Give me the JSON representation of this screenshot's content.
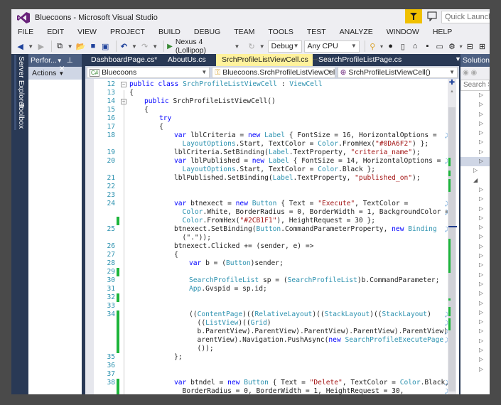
{
  "window": {
    "title": "Bluecoons - Microsoft Visual Studio",
    "quick_launch_placeholder": "Quick Launch (Ctrl+Q)"
  },
  "menu": [
    "FILE",
    "EDIT",
    "VIEW",
    "PROJECT",
    "BUILD",
    "DEBUG",
    "TEAM",
    "TOOLS",
    "TEST",
    "ANALYZE",
    "WINDOW",
    "HELP"
  ],
  "toolbar": {
    "run_target": "Nexus 4 (Lollipop)",
    "configuration": "Debug",
    "platform": "Any CPU"
  },
  "side_tabs": [
    "Server Explorer",
    "Toolbox"
  ],
  "perf_panel": {
    "title": "Perfor...",
    "actions_label": "Actions"
  },
  "doc_tabs": [
    {
      "label": "DashboardPage.cs*",
      "active": false
    },
    {
      "label": "AboutUs.cs",
      "active": false
    },
    {
      "label": "SrchProfileListViewCell.cs",
      "active": true
    },
    {
      "label": "SearchProfileListPage.cs",
      "active": false
    }
  ],
  "navbar": {
    "project": "Bluecoons",
    "type": "Bluecoons.SrchProfileListViewCell",
    "member": "SrchProfileListViewCell()"
  },
  "solution_explorer": {
    "title": "Solution Explorer",
    "search_placeholder": "Search Solution Explorer"
  },
  "code_lines": [
    {
      "n": "12",
      "fold": true,
      "segs": [
        [
          "kw",
          "public class "
        ],
        [
          "ty",
          "SrchProfileListViewCell"
        ],
        [
          "",
          " : "
        ],
        [
          "ty",
          "ViewCell"
        ]
      ],
      "indent": 0
    },
    {
      "n": "13",
      "segs": [
        [
          "",
          "{"
        ]
      ],
      "indent": 0
    },
    {
      "n": "14",
      "fold": true,
      "segs": [
        [
          "kw",
          "public "
        ],
        [
          "",
          "SrchProfileListViewCell()"
        ]
      ],
      "indent": 1
    },
    {
      "n": "15",
      "segs": [
        [
          "",
          "{"
        ]
      ],
      "indent": 1
    },
    {
      "n": "16",
      "segs": [
        [
          "kw",
          "try"
        ]
      ],
      "indent": 2
    },
    {
      "n": "17",
      "segs": [
        [
          "",
          "{"
        ]
      ],
      "indent": 2
    },
    {
      "n": "18",
      "wrap": true,
      "segs": [
        [
          "kw",
          "var "
        ],
        [
          "",
          "lblCriteria = "
        ],
        [
          "kw",
          "new "
        ],
        [
          "ty",
          "Label"
        ],
        [
          "",
          " { FontSize = 16, HorizontalOptions = "
        ]
      ],
      "indent": 3
    },
    {
      "n": "",
      "segs": [
        [
          "ty",
          "  LayoutOptions"
        ],
        [
          "",
          ".Start, TextColor = "
        ],
        [
          "ty",
          "Color"
        ],
        [
          "",
          ".FromHex("
        ],
        [
          "st",
          "\"#0DA6F2\""
        ],
        [
          "",
          ") };"
        ]
      ],
      "indent": 3
    },
    {
      "n": "19",
      "segs": [
        [
          "",
          "lblCriteria.SetBinding("
        ],
        [
          "ty",
          "Label"
        ],
        [
          "",
          ".TextProperty, "
        ],
        [
          "st",
          "\"criteria_name\""
        ],
        [
          "",
          ");"
        ]
      ],
      "indent": 3
    },
    {
      "n": "20",
      "wrap": true,
      "segs": [
        [
          "kw",
          "var "
        ],
        [
          "",
          "lblPublished = "
        ],
        [
          "kw",
          "new "
        ],
        [
          "ty",
          "Label"
        ],
        [
          "",
          " { FontSize = 14, HorizontalOptions = "
        ]
      ],
      "indent": 3
    },
    {
      "n": "",
      "segs": [
        [
          "ty",
          "  LayoutOptions"
        ],
        [
          "",
          ".Start, TextColor = "
        ],
        [
          "ty",
          "Color"
        ],
        [
          "",
          ".Black };"
        ]
      ],
      "indent": 3
    },
    {
      "n": "21",
      "segs": [
        [
          "",
          "lblPublished.SetBinding("
        ],
        [
          "ty",
          "Label"
        ],
        [
          "",
          ".TextProperty, "
        ],
        [
          "st",
          "\"published_on\""
        ],
        [
          "",
          ");"
        ]
      ],
      "indent": 3
    },
    {
      "n": "22",
      "segs": [],
      "indent": 3
    },
    {
      "n": "23",
      "segs": [],
      "indent": 3
    },
    {
      "n": "24",
      "wrap": true,
      "segs": [
        [
          "kw",
          "var "
        ],
        [
          "",
          "btnexect = "
        ],
        [
          "kw",
          "new "
        ],
        [
          "ty",
          "Button"
        ],
        [
          "",
          " { Text = "
        ],
        [
          "st",
          "\"Execute\""
        ],
        [
          "",
          ", TextColor = "
        ]
      ],
      "indent": 3
    },
    {
      "n": "",
      "wrap": true,
      "segs": [
        [
          "ty",
          "  Color"
        ],
        [
          "",
          ".White, BorderRadius = 0, BorderWidth = 1, BackgroundColor = "
        ]
      ],
      "indent": 3
    },
    {
      "n": "",
      "chg": true,
      "segs": [
        [
          "ty",
          "  Color"
        ],
        [
          "",
          ".FromHex("
        ],
        [
          "st",
          "\"#2CB1F1\""
        ],
        [
          "",
          "), HeightRequest = 30 };"
        ]
      ],
      "indent": 3
    },
    {
      "n": "25",
      "wrap": true,
      "segs": [
        [
          "",
          "btnexect.SetBinding("
        ],
        [
          "ty",
          "Button"
        ],
        [
          "",
          ".CommandParameterProperty, "
        ],
        [
          "kw",
          "new "
        ],
        [
          "ty",
          "Binding"
        ]
      ],
      "indent": 3
    },
    {
      "n": "",
      "segs": [
        [
          "",
          "  (\".\"));"
        ]
      ],
      "indent": 3
    },
    {
      "n": "26",
      "segs": [
        [
          "",
          "btnexect.Clicked += (sender, e) =>"
        ]
      ],
      "indent": 3
    },
    {
      "n": "27",
      "segs": [
        [
          "",
          "{"
        ]
      ],
      "indent": 3
    },
    {
      "n": "28",
      "segs": [
        [
          "kw",
          "var "
        ],
        [
          "",
          "b = ("
        ],
        [
          "ty",
          "Button"
        ],
        [
          "",
          ")sender;"
        ]
      ],
      "indent": 4
    },
    {
      "n": "29",
      "chg": true,
      "segs": [],
      "indent": 4
    },
    {
      "n": "30",
      "segs": [
        [
          "ty",
          "SearchProfileList"
        ],
        [
          "",
          " sp = ("
        ],
        [
          "ty",
          "SearchProfileList"
        ],
        [
          "",
          ")b.CommandParameter;"
        ]
      ],
      "indent": 4
    },
    {
      "n": "31",
      "segs": [
        [
          "ty",
          "App"
        ],
        [
          "",
          ".Gvspid = sp.id;"
        ]
      ],
      "indent": 4
    },
    {
      "n": "32",
      "chg": true,
      "segs": [],
      "indent": 4
    },
    {
      "n": "33",
      "segs": [],
      "indent": 4
    },
    {
      "n": "34",
      "chg": true,
      "wrap": true,
      "segs": [
        [
          "",
          "(("
        ],
        [
          "ty",
          "ContentPage"
        ],
        [
          "",
          ")(("
        ],
        [
          "ty",
          "RelativeLayout"
        ],
        [
          "",
          ")(("
        ],
        [
          "ty",
          "StackLayout"
        ],
        [
          "",
          ")(("
        ],
        [
          "ty",
          "StackLayout"
        ],
        [
          "",
          ")"
        ]
      ],
      "indent": 4
    },
    {
      "n": "",
      "chg": true,
      "wrap": true,
      "segs": [
        [
          "",
          "  (("
        ],
        [
          "ty",
          "ListView"
        ],
        [
          "",
          ")(("
        ],
        [
          "ty",
          "Grid"
        ],
        [
          "",
          ")"
        ]
      ],
      "indent": 4
    },
    {
      "n": "",
      "chg": true,
      "wrap": true,
      "segs": [
        [
          "",
          "  b.ParentView).ParentView).ParentView).ParentView).ParentView).P"
        ]
      ],
      "indent": 4
    },
    {
      "n": "",
      "chg": true,
      "wrap": true,
      "segs": [
        [
          "",
          "  arentView).Navigation.PushAsync("
        ],
        [
          "kw",
          "new "
        ],
        [
          "ty",
          "SearchProfileExecutePage"
        ]
      ],
      "indent": 4
    },
    {
      "n": "",
      "chg": true,
      "segs": [
        [
          "",
          "  ());"
        ]
      ],
      "indent": 4
    },
    {
      "n": "35",
      "segs": [
        [
          "",
          "};"
        ]
      ],
      "indent": 3
    },
    {
      "n": "36",
      "segs": [],
      "indent": 3
    },
    {
      "n": "37",
      "segs": [],
      "indent": 3
    },
    {
      "n": "38",
      "chg": true,
      "wrap": true,
      "segs": [
        [
          "kw",
          "var "
        ],
        [
          "",
          "btndel = "
        ],
        [
          "kw",
          "new "
        ],
        [
          "ty",
          "Button"
        ],
        [
          "",
          " { Text = "
        ],
        [
          "st",
          "\"Delete\""
        ],
        [
          "",
          ", TextColor = "
        ],
        [
          "ty",
          "Color"
        ],
        [
          "",
          ".Black,"
        ]
      ],
      "indent": 3
    },
    {
      "n": "",
      "chg": true,
      "wrap": true,
      "segs": [
        [
          "",
          "  BorderRadius = 0, BorderWidth = 1, HeightRequest = 30,"
        ]
      ],
      "indent": 3
    }
  ]
}
